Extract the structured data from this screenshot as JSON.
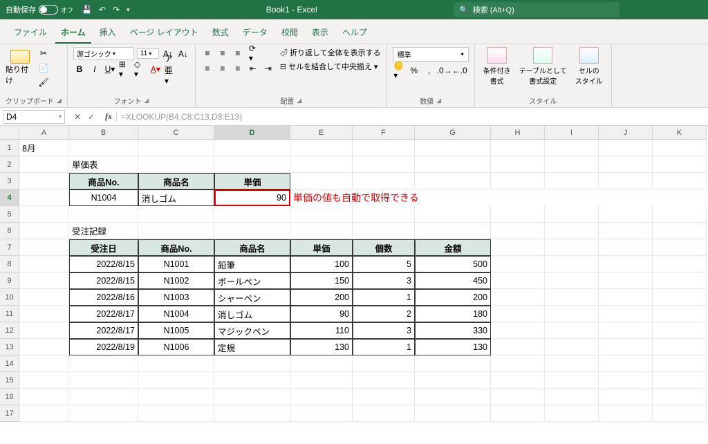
{
  "titlebar": {
    "autosave": "自動保存",
    "autosave_state": "オフ",
    "doc_title": "Book1  -  Excel",
    "search_placeholder": "検索 (Alt+Q)"
  },
  "tabs": [
    "ファイル",
    "ホーム",
    "挿入",
    "ページ レイアウト",
    "数式",
    "データ",
    "校閲",
    "表示",
    "ヘルプ"
  ],
  "active_tab": 1,
  "ribbon": {
    "clipboard": {
      "paste": "貼り付け",
      "label": "クリップボード"
    },
    "font": {
      "name": "游ゴシック",
      "size": "11",
      "label": "フォント"
    },
    "align": {
      "wrap": "折り返して全体を表示する",
      "merge": "セルを結合して中央揃え",
      "label": "配置"
    },
    "number": {
      "format": "標準",
      "label": "数値"
    },
    "styles": {
      "cond": "条件付き\n書式",
      "table": "テーブルとして\n書式設定",
      "cell": "セルの\nスタイル",
      "label": "スタイル"
    }
  },
  "namebox": "D4",
  "formula": "=XLOOKUP(B4,C8:C13,D8:E13)",
  "annotation": "単価の値も自動で取得できる",
  "month": "8月",
  "price_table": {
    "title": "単価表",
    "headers": [
      "商品No.",
      "商品名",
      "単価"
    ],
    "row": {
      "no": "N1004",
      "name": "消しゴム",
      "price": "90"
    }
  },
  "orders": {
    "title": "受注記録",
    "headers": [
      "受注日",
      "商品No.",
      "商品名",
      "単価",
      "個数",
      "金額"
    ],
    "rows": [
      {
        "date": "2022/8/15",
        "no": "N1001",
        "name": "鉛筆",
        "price": "100",
        "qty": "5",
        "amount": "500"
      },
      {
        "date": "2022/8/15",
        "no": "N1002",
        "name": "ボールペン",
        "price": "150",
        "qty": "3",
        "amount": "450"
      },
      {
        "date": "2022/8/16",
        "no": "N1003",
        "name": "シャーペン",
        "price": "200",
        "qty": "1",
        "amount": "200"
      },
      {
        "date": "2022/8/17",
        "no": "N1004",
        "name": "消しゴム",
        "price": "90",
        "qty": "2",
        "amount": "180"
      },
      {
        "date": "2022/8/17",
        "no": "N1005",
        "name": "マジックペン",
        "price": "110",
        "qty": "3",
        "amount": "330"
      },
      {
        "date": "2022/8/19",
        "no": "N1006",
        "name": "定規",
        "price": "130",
        "qty": "1",
        "amount": "130"
      }
    ]
  },
  "columns": [
    "A",
    "B",
    "C",
    "D",
    "E",
    "F",
    "G",
    "H",
    "I",
    "J",
    "K"
  ]
}
